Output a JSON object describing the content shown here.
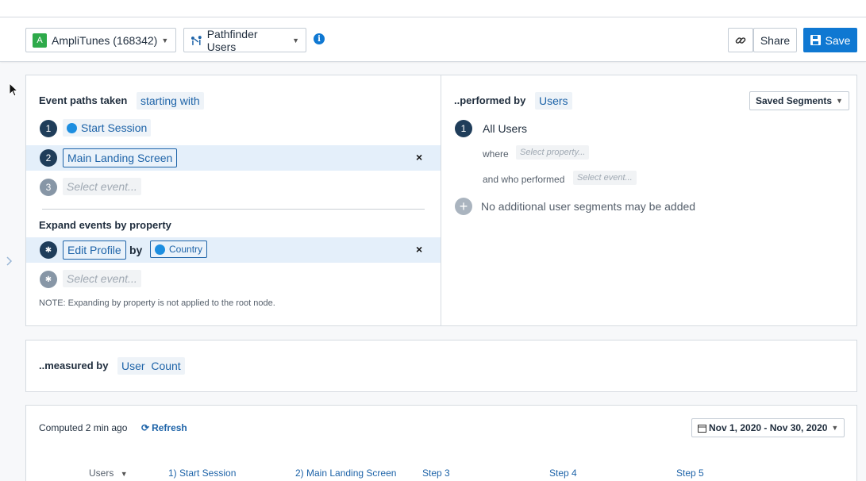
{
  "header": {
    "app": {
      "badge": "A",
      "label": "AmpliTunes (168342)"
    },
    "chart_type": {
      "label": "Pathfinder Users"
    },
    "info": "i",
    "share_label": "Share",
    "save_label": "Save"
  },
  "events": {
    "title": "Event paths taken",
    "mode": "starting with",
    "steps": [
      {
        "num": "1",
        "label": "Start Session"
      },
      {
        "num": "2",
        "label": "Main Landing Screen"
      },
      {
        "num": "3",
        "placeholder": "Select event..."
      }
    ],
    "remove": "×"
  },
  "expand": {
    "title": "Expand events by property",
    "event": "Edit Profile",
    "by": "by",
    "property": "Country",
    "placeholder": "Select event...",
    "bullet": "✱",
    "note": "NOTE: Expanding by property is not applied to the root node."
  },
  "segments": {
    "title": "..performed by",
    "target": "Users",
    "saved_label": "Saved Segments",
    "segment_num": "1",
    "segment_name": "All Users",
    "where_label": "where",
    "where_placeholder": "Select property...",
    "who_label": "and who performed",
    "who_placeholder": "Select event...",
    "add_icon": "+",
    "no_more": "No additional user segments may be added"
  },
  "measured": {
    "title": "..measured by",
    "metric": "User  Count"
  },
  "results": {
    "computed": "Computed 2 min ago",
    "refresh": "Refresh",
    "date_range": "Nov 1, 2020 - Nov 30, 2020",
    "columns": [
      "Users",
      "1) Start Session",
      "2) Main Landing Screen",
      "Step 3",
      "Step 4",
      "Step 5"
    ]
  },
  "colors": {
    "accent": "#0f78d2",
    "step_dark": "#1f3d5a",
    "highlight": "#e4effa"
  }
}
